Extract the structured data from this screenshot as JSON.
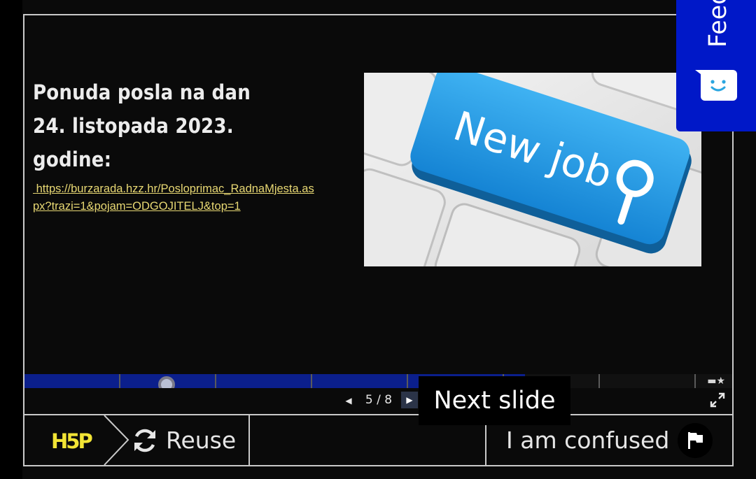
{
  "slide": {
    "title": "Ponuda posla na dan 24. listopada 2023. godine:",
    "link_text": " https://burzarada.hzz.hr/Posloprimac_RadnaMjesta.aspx?trazi=1&pojam=ODGOJITELJ&top=1",
    "image_text": "New job"
  },
  "progress": {
    "current": 5,
    "total": 8,
    "fraction_complete": 0.67
  },
  "navigation": {
    "prev_icon": "caret-left-icon",
    "next_icon": "caret-right-icon",
    "counter": "5 / 8",
    "next_tooltip": "Next slide",
    "fullscreen_icon": "fullscreen-icon"
  },
  "footer": {
    "logo_text": "H5P",
    "reuse_label": "Reuse",
    "reuse_icon": "refresh-icon",
    "confused_label": "I am confused",
    "flag_icon": "flag-icon"
  },
  "feedback": {
    "label": "Feedback",
    "icon": "smiley-face-icon"
  },
  "colors": {
    "progress_fill": "#0b1f8c",
    "link": "#e8d873",
    "feedback_tab": "#0018c8",
    "logo": "#f2e435",
    "key_blue": "#1e9be6"
  }
}
